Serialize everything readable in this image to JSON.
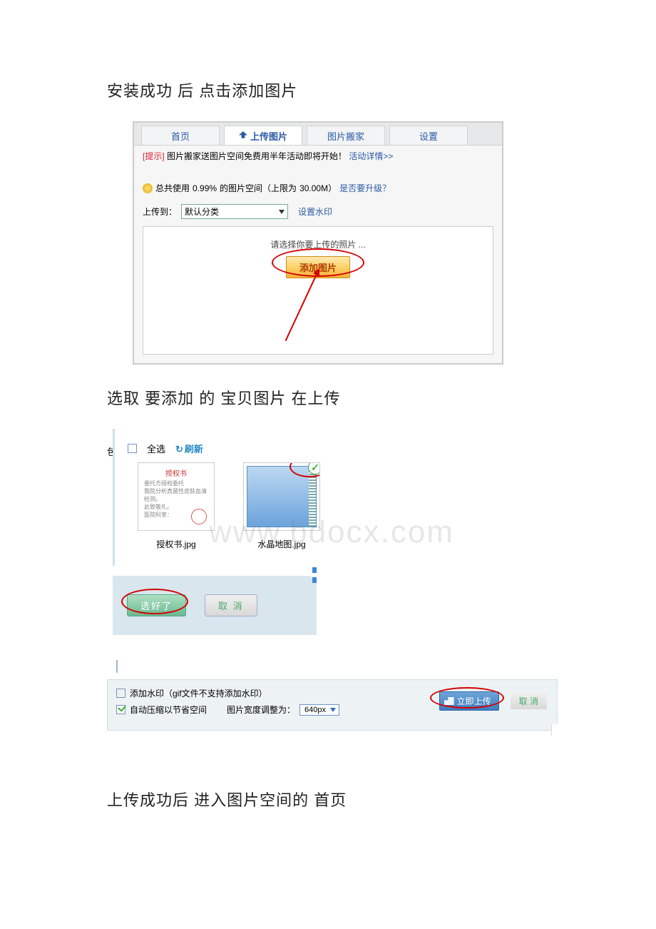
{
  "watermark": "www.bdocx.com",
  "instructions": {
    "step1": "安装成功 后 点击添加图片",
    "step2": "选取 要添加 的 宝贝图片 在上传",
    "step3": "上传成功后 进入图片空间的 首页"
  },
  "shot1": {
    "tabs": {
      "home": "首页",
      "upload": "上传图片",
      "move": "图片搬家",
      "settings": "设置"
    },
    "promo": {
      "tag": "[提示]",
      "text": "图片搬家送图片空间免费用半年活动即将开始！",
      "link": "活动详情>>"
    },
    "usage": {
      "prefix": "总共使用",
      "percent": "0.99%",
      "mid": "的图片空间（上限为",
      "limit": "30.00M）",
      "upgrade": "是否要升级？"
    },
    "uploadTo": "上传到：",
    "category": "默认分类",
    "watermark": "设置水印",
    "hint": "请选择你要上传的照片 ...",
    "addBtn": "添加图片"
  },
  "shot2": {
    "edge": "包",
    "selectAll": "全选",
    "refresh": "刷新",
    "thumb1": {
      "title": "授权书",
      "file": "授权书.jpg"
    },
    "thumb2": {
      "file": "水晶地图.jpg"
    },
    "confirm": "选好了",
    "cancel": "取 消"
  },
  "shot3": {
    "addWm": "添加水印（gif文件不支持添加水印）",
    "compress": "自动压缩以节省空间",
    "widthLabel": "图片宽度调整为：",
    "widthValue": "640px",
    "uploadNow": "立即上传",
    "cancel": "取 消"
  }
}
